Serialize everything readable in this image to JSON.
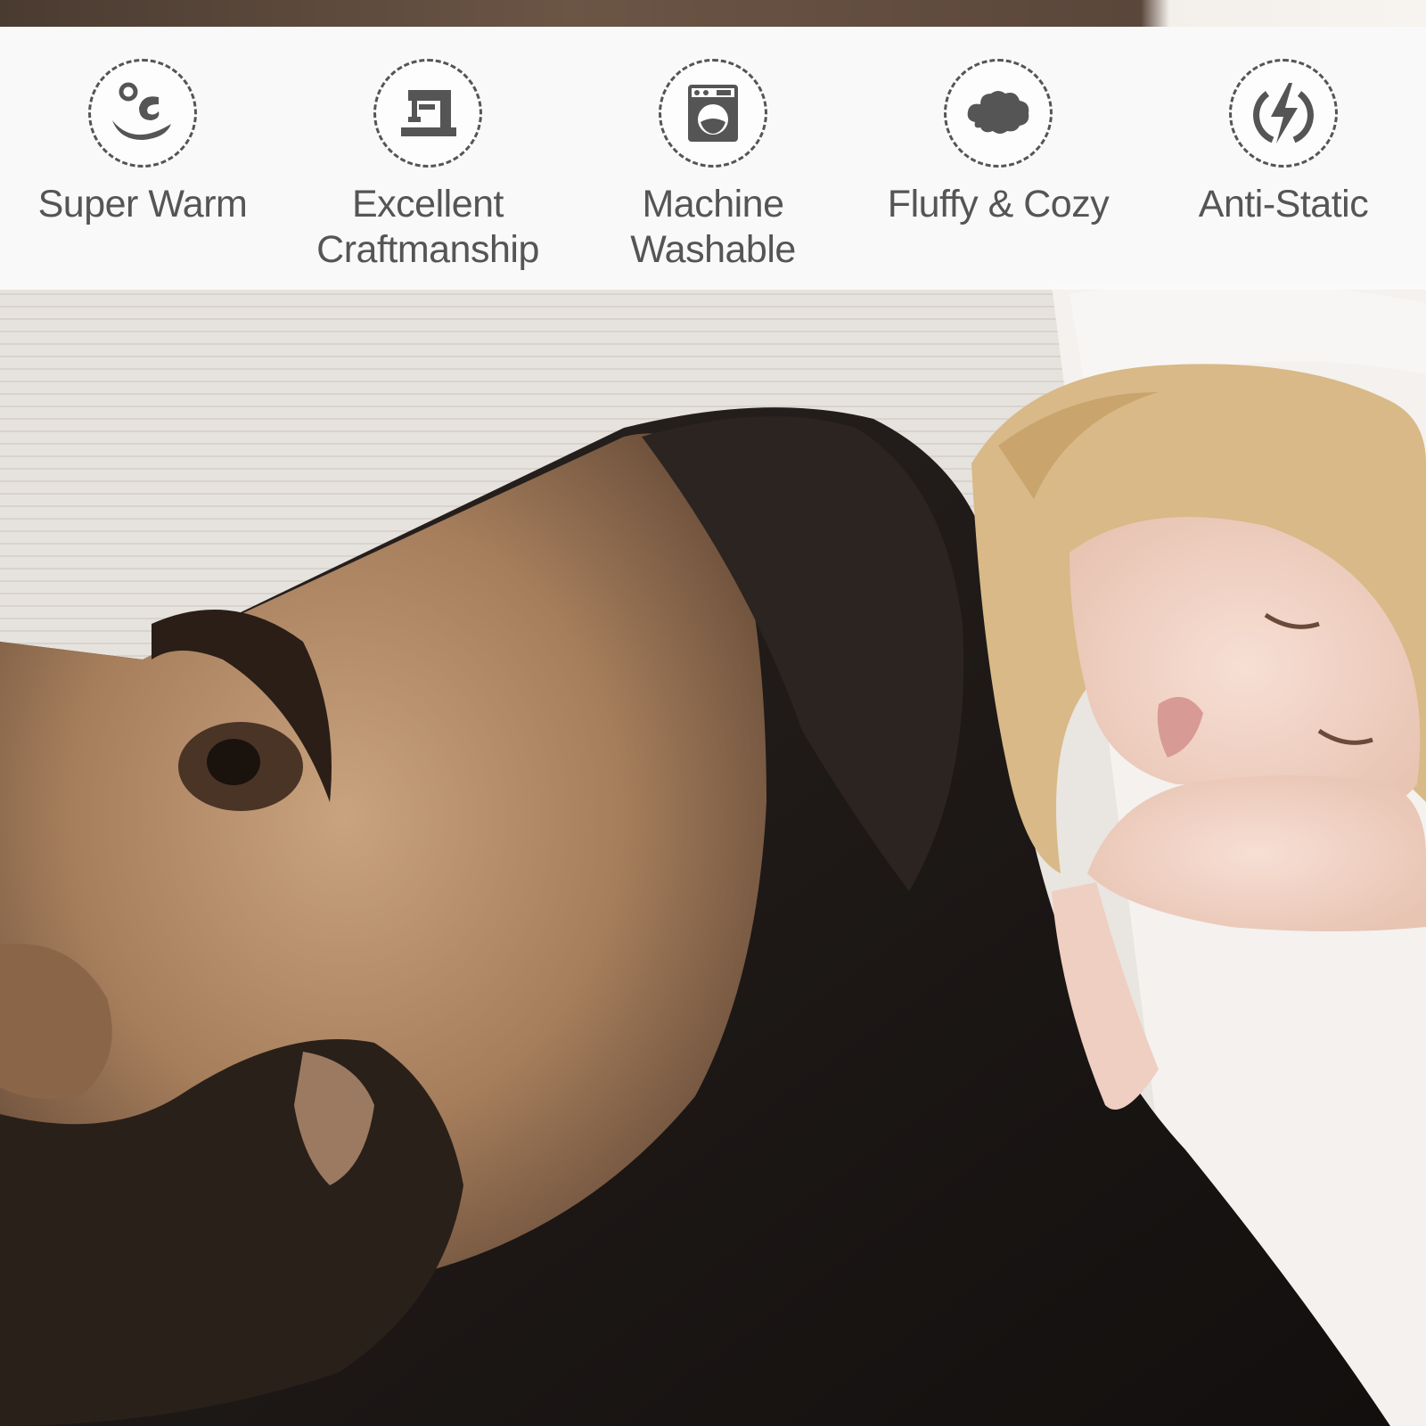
{
  "features": [
    {
      "label": "Super Warm",
      "icon": "warmth-icon"
    },
    {
      "label": "Excellent\nCraftmanship",
      "icon": "sewing-machine-icon"
    },
    {
      "label": "Machine\nWashable",
      "icon": "washing-machine-icon"
    },
    {
      "label": "Fluffy & Cozy",
      "icon": "cloud-icon"
    },
    {
      "label": "Anti-Static",
      "icon": "lightning-bolt-icon"
    }
  ],
  "colors": {
    "icon": "#555555",
    "label": "#555555",
    "band": "#fafafa",
    "blanket_dark": "#1e1a18",
    "skin": "#b08a68",
    "hair": "#dcbf8a",
    "pillow": "#efece8"
  }
}
